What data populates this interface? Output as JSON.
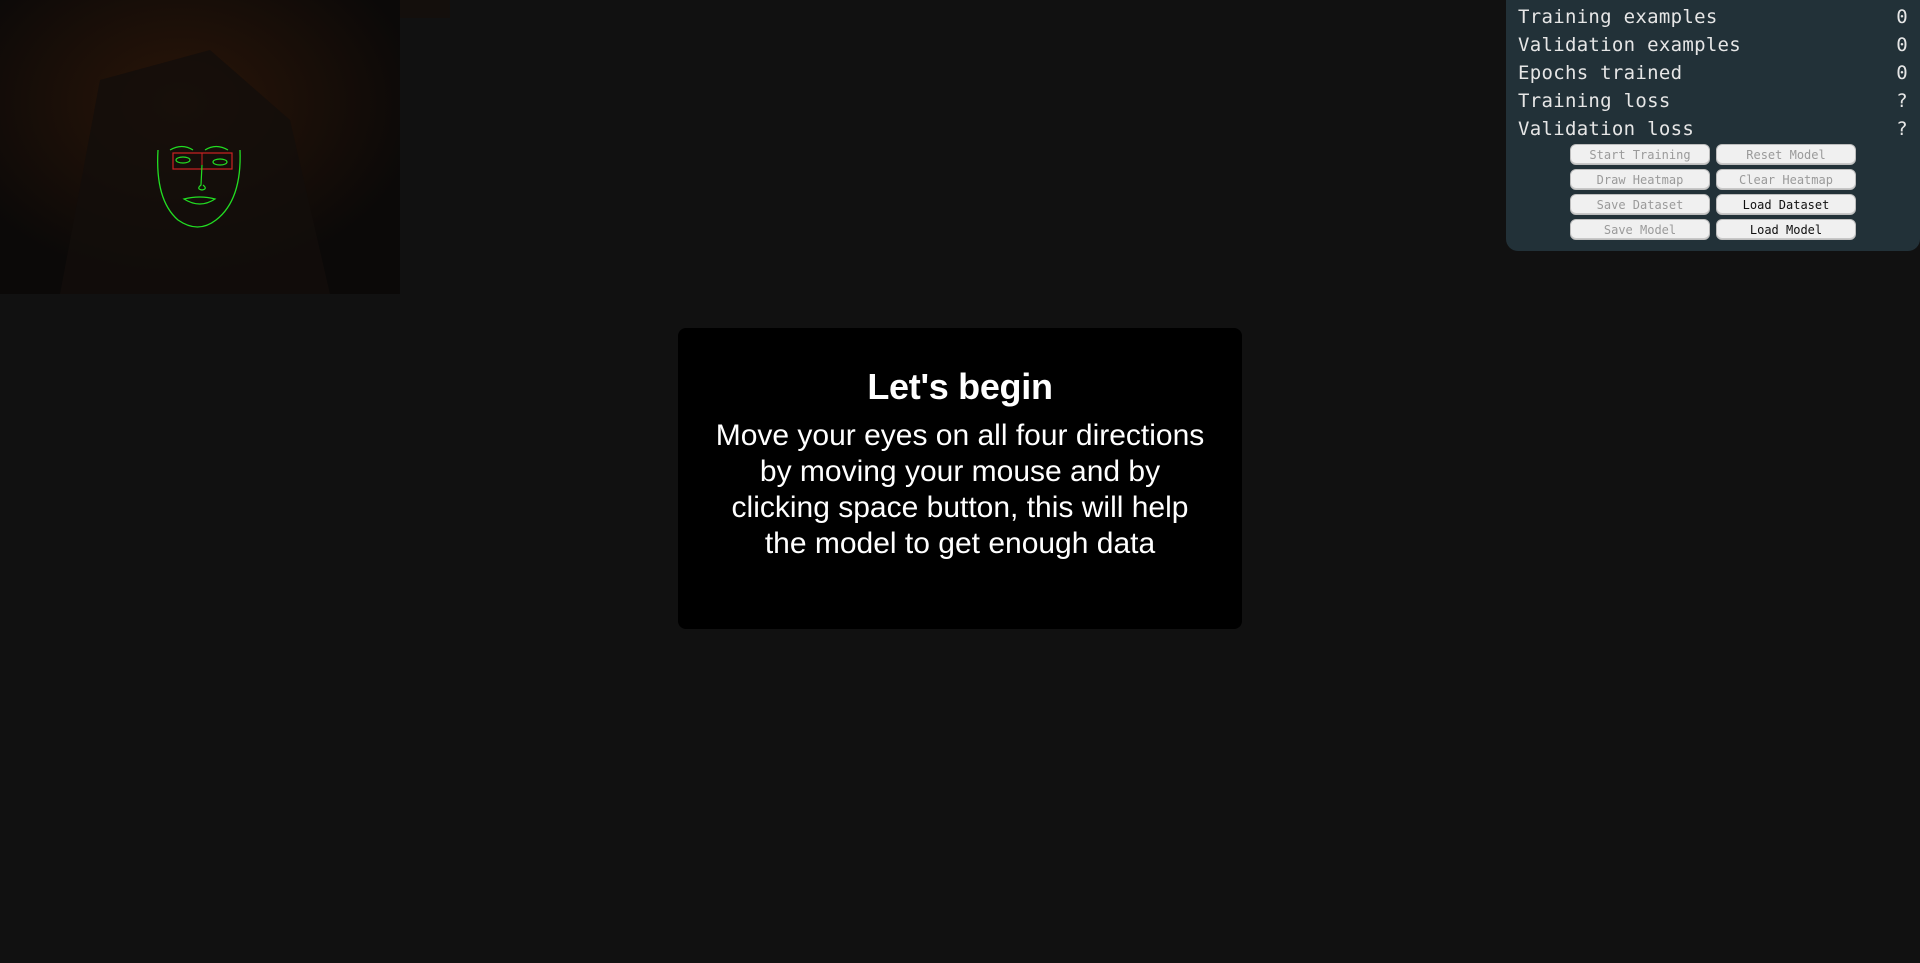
{
  "stats": [
    {
      "label": "Training examples",
      "value": "0"
    },
    {
      "label": "Validation examples",
      "value": "0"
    },
    {
      "label": "Epochs trained",
      "value": "0"
    },
    {
      "label": "Training loss",
      "value": "?"
    },
    {
      "label": "Validation loss",
      "value": "?"
    }
  ],
  "buttons": {
    "start_training": "Start Training",
    "reset_model": "Reset Model",
    "draw_heatmap": "Draw Heatmap",
    "clear_heatmap": "Clear Heatmap",
    "save_dataset": "Save Dataset",
    "load_dataset": "Load Dataset",
    "save_model": "Save Model",
    "load_model": "Load Model"
  },
  "modal": {
    "title": "Let's begin",
    "body": "Move your eyes on all four directions by moving your mouse and by clicking space button, this will help the model to get enough data"
  },
  "colors": {
    "background": "#111111",
    "panel": "#223138",
    "face_overlay": "#22dd22",
    "eye_box": "#cc2222"
  }
}
